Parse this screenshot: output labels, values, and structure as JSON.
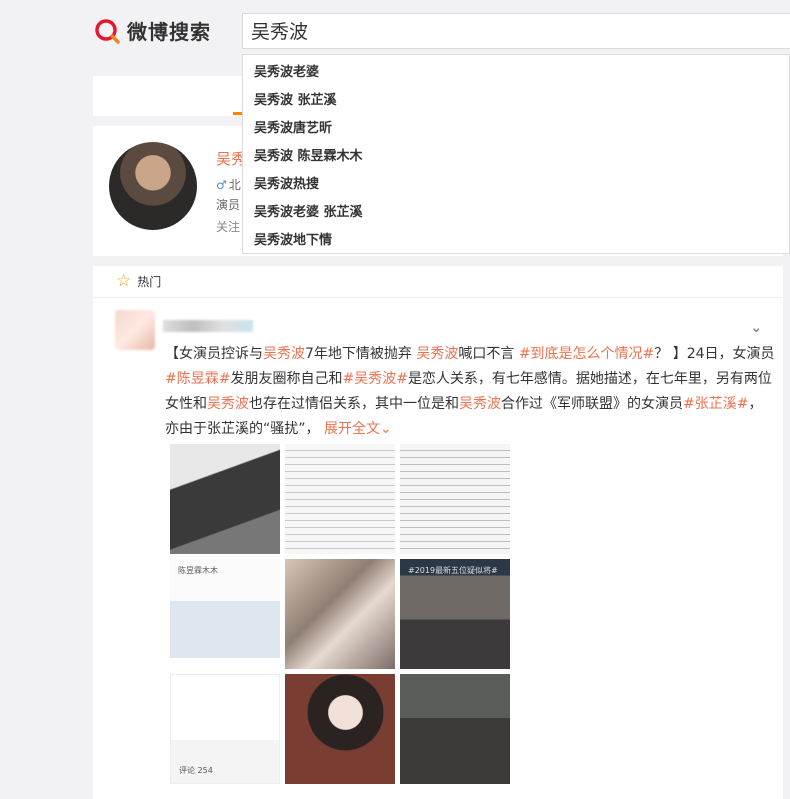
{
  "header": {
    "logo_text": "微博搜索",
    "search_value": "吴秀波"
  },
  "suggestions": [
    "吴秀波老婆",
    "吴秀波 张芷溪",
    "吴秀波唐艺昕",
    "吴秀波 陈昱霖木木",
    "吴秀波热搜",
    "吴秀波老婆 张芷溪",
    "吴秀波地下情"
  ],
  "user_card": {
    "name": "吴秀",
    "location": "北",
    "desc": "演员",
    "follow": "关注"
  },
  "feed": {
    "hot_label": "热门",
    "post": {
      "p1": "【女演员控诉与",
      "t1": "吴秀波",
      "p2": "7年地下情被抛弃 ",
      "t2": "吴秀波",
      "p3": "喊口不言 ",
      "t3": "#到底是怎么个情况#",
      "p4": "？ 】24日，女演员",
      "t4": "#陈昱霖#",
      "p5": "发朋友圈称自己和",
      "t5": "#吴秀波#",
      "p6": "是恋人关系，有七年感情。据她描述，在七年里，另有两位女性和",
      "t6": "吴秀波",
      "p7": "也存在过情侣关系，其中一位是和",
      "t7": "吴秀波",
      "p8": "合作过《军师联盟》的女演员",
      "t8": "#张芷溪#",
      "p9": "，亦由于张芷溪的“骚扰”，",
      "expand": "展开全文"
    },
    "images": {
      "c4_label": "陈昱霖木木",
      "c6_label": "#2019最新五位疑似将#",
      "c7_label": "评论 254"
    }
  },
  "colors": {
    "accent": "#eb7350",
    "tab_indicator": "#ff8200"
  }
}
